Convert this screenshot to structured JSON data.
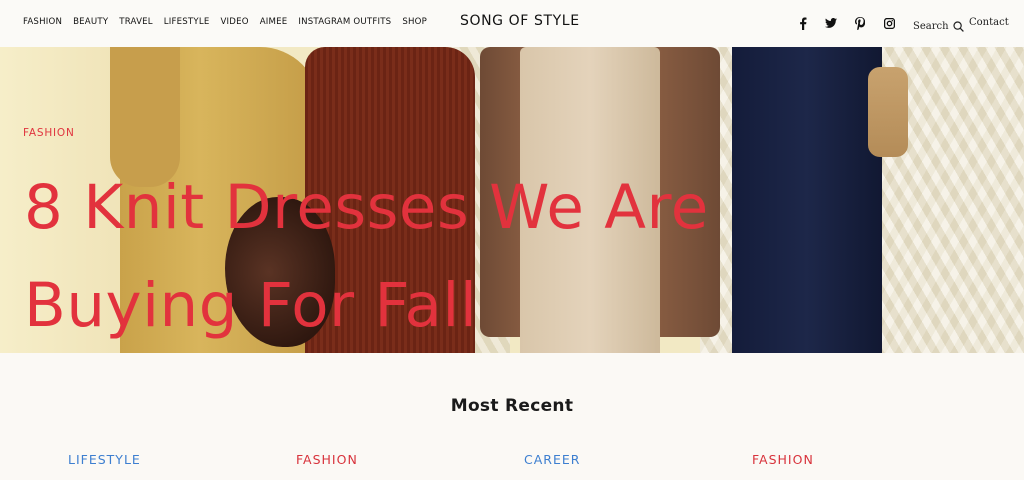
{
  "header": {
    "nav_items": [
      "FASHION",
      "BEAUTY",
      "TRAVEL",
      "LIFESTYLE",
      "VIDEO",
      "AIMEE",
      "INSTAGRAM OUTFITS",
      "SHOP"
    ],
    "logo": "SONG OF STYLE",
    "social_icons": [
      "facebook-icon",
      "twitter-icon",
      "pinterest-icon",
      "instagram-icon"
    ],
    "search_label": "Search",
    "contact_label": "Contact"
  },
  "hero": {
    "category": "FASHION",
    "title_line1": "8 Knit Dresses We Are",
    "title_line2": "Buying For Fall"
  },
  "recent": {
    "heading": "Most Recent",
    "categories": [
      {
        "label": "LIFESTYLE",
        "color": "#3d7fd0"
      },
      {
        "label": "FASHION",
        "color": "#d8333c"
      },
      {
        "label": "CAREER",
        "color": "#3d7fd0"
      },
      {
        "label": "FASHION",
        "color": "#d8333c"
      }
    ]
  },
  "colors": {
    "accent_red": "#e2323d",
    "accent_blue": "#3d7fd0"
  }
}
